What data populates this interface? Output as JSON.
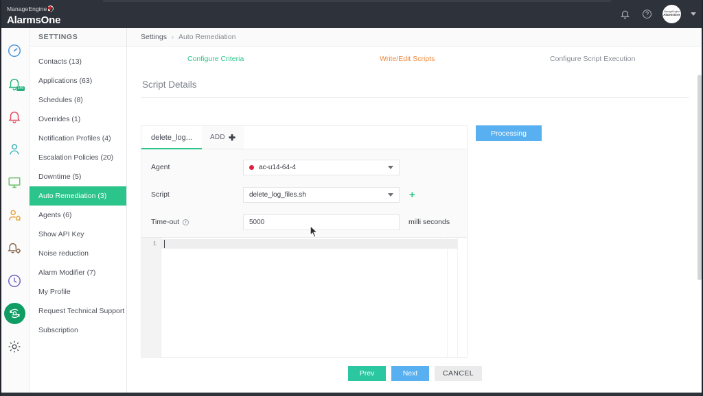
{
  "header": {
    "logo_brand": "ManageEngine",
    "logo_product": "AlarmsOne",
    "icons": [
      "notifications-bell-icon",
      "help-icon"
    ],
    "avatar_line1": "ManageEngine",
    "avatar_line2": "AlarmsOne"
  },
  "rail": {
    "items": [
      {
        "name": "dashboard-gauge-icon",
        "color": "#4a93d9",
        "active": false,
        "badge": ""
      },
      {
        "name": "alarms-bell-icon",
        "color": "#2bb57e",
        "active": false,
        "badge": "149"
      },
      {
        "name": "alerts-bell-icon",
        "color": "#e24b5e",
        "active": false,
        "badge": ""
      },
      {
        "name": "contacts-user-icon",
        "color": "#39b3b8",
        "active": false,
        "badge": ""
      },
      {
        "name": "monitors-screen-icon",
        "color": "#6cbf6a",
        "active": false,
        "badge": ""
      },
      {
        "name": "user-group-icon",
        "color": "#e8a33d",
        "active": false,
        "badge": ""
      },
      {
        "name": "alarm-settings-icon",
        "color": "#8a6a52",
        "active": false,
        "badge": ""
      },
      {
        "name": "history-clock-icon",
        "color": "#6d63c4",
        "active": false,
        "badge": ""
      },
      {
        "name": "auto-remediation-icon",
        "color": "#ffffff",
        "active": true,
        "badge": ""
      },
      {
        "name": "settings-gear-icon",
        "color": "#4a4d54",
        "active": false,
        "badge": ""
      }
    ]
  },
  "sidebar": {
    "title": "SETTINGS",
    "items": [
      {
        "label": "Contacts (13)",
        "selected": false
      },
      {
        "label": "Applications (63)",
        "selected": false
      },
      {
        "label": "Schedules (8)",
        "selected": false
      },
      {
        "label": "Overrides (1)",
        "selected": false
      },
      {
        "label": "Notification Profiles (4)",
        "selected": false
      },
      {
        "label": "Escalation Policies (20)",
        "selected": false
      },
      {
        "label": "Downtime (5)",
        "selected": false
      },
      {
        "label": "Auto Remediation (3)",
        "selected": true
      },
      {
        "label": "Agents (6)",
        "selected": false
      },
      {
        "label": "Show API Key",
        "selected": false
      },
      {
        "label": "Noise reduction",
        "selected": false
      },
      {
        "label": "Alarm Modifier (7)",
        "selected": false
      },
      {
        "label": "My Profile",
        "selected": false
      },
      {
        "label": "Request Technical Support",
        "selected": false
      },
      {
        "label": "Subscription",
        "selected": false
      }
    ]
  },
  "breadcrumb": {
    "root": "Settings",
    "separator": "›",
    "current": "Auto Remediation"
  },
  "wizard": {
    "steps": [
      {
        "label": "Configure Criteria",
        "state": "done",
        "color": "#2bc48a"
      },
      {
        "label": "Write/Edit Scripts",
        "state": "current",
        "color": "#f0883a"
      },
      {
        "label": "Configure Script Execution",
        "state": "todo",
        "color": "#8a8e95"
      }
    ]
  },
  "panel": {
    "title": "Script Details",
    "tab_label": "delete_log...",
    "add_label": "ADD",
    "add_plus": "✚"
  },
  "form": {
    "agent": {
      "label": "Agent",
      "value": "ac-u14-64-4",
      "status_color": "#e0203f"
    },
    "script": {
      "label": "Script",
      "value": "delete_log_files.sh",
      "add_new": "+"
    },
    "timeout": {
      "label": "Time-out",
      "info": "i",
      "value": "5000",
      "unit": "milli seconds"
    }
  },
  "editor": {
    "line_numbers": [
      "1"
    ],
    "content": ""
  },
  "processing_button": {
    "label": "Processing",
    "color": "#58b0f0"
  },
  "footer": {
    "prev": "Prev",
    "next": "Next",
    "cancel": "CANCEL"
  }
}
